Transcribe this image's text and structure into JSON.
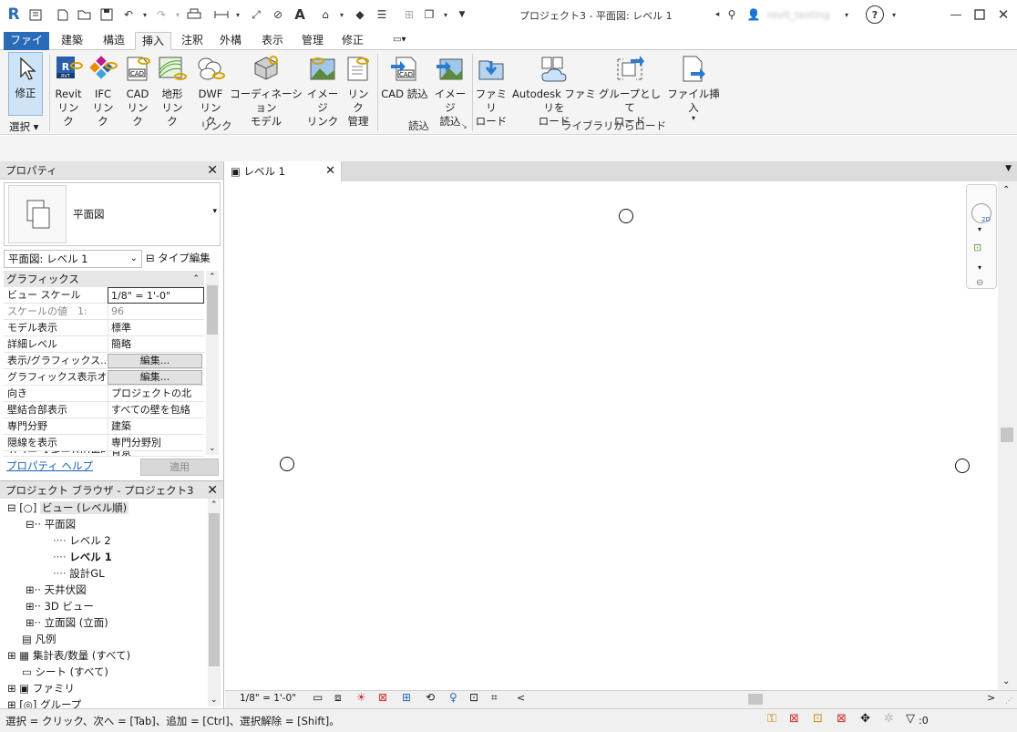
{
  "title_bar": {
    "title": "プロジェクト3 - 平面図: レベル 1",
    "user_name": "revit_testing",
    "help_label": "?"
  },
  "ribbon_tabs": [
    "ファイル",
    "建築",
    "構造",
    "挿入",
    "注釈",
    "外構",
    "表示",
    "管理",
    "修正"
  ],
  "ribbon": {
    "modify_label": "修正",
    "select_label": "選択",
    "buttons": {
      "revit_link": [
        "Revit",
        "リンク"
      ],
      "ifc_link": [
        "IFC",
        "リンク"
      ],
      "cad_link": [
        "CAD",
        "リンク"
      ],
      "topo_link": [
        "地形",
        "リンク"
      ],
      "dwf_link": [
        "DWF",
        "リンク"
      ],
      "coord_model": [
        "コーディネーション",
        "モデル"
      ],
      "image_link": [
        "イメージ",
        "リンク"
      ],
      "manage_links": [
        "リンク",
        "管理"
      ],
      "cad_import": [
        "CAD 読込",
        ""
      ],
      "image_import": [
        "イメージ",
        "読込"
      ],
      "load_family": [
        "ファミリ",
        "ロード"
      ],
      "autodesk_family": [
        "Autodesk ファミリを",
        "ロード"
      ],
      "load_group": [
        "グループとして",
        "ロード"
      ],
      "insert_file": [
        "ファイル挿入",
        ""
      ]
    },
    "panels": {
      "link": "リンク",
      "import": "読込",
      "load_library": "ライブラリからロード"
    },
    "cad_icon_text": "CAD",
    "rvt_icon_text": "RVT"
  },
  "properties": {
    "header": "プロパティ",
    "type_name": "平面図",
    "instance_selector": "平面図: レベル 1",
    "edit_type": "タイプ編集",
    "group": "グラフィックス",
    "rows": [
      {
        "k": "ビュー スケール",
        "v": "1/8\" = 1'-0\""
      },
      {
        "k": "スケールの値　1:",
        "v": "96"
      },
      {
        "k": "モデル表示",
        "v": "標準"
      },
      {
        "k": "詳細レベル",
        "v": "簡略"
      },
      {
        "k": "表示/グラフィックス...",
        "v": "編集..."
      },
      {
        "k": "グラフィックス表示オ...",
        "v": "編集..."
      },
      {
        "k": "向き",
        "v": "プロジェクトの北"
      },
      {
        "k": "壁結合部表示",
        "v": "すべての壁を包絡"
      },
      {
        "k": "専門分野",
        "v": "建築"
      },
      {
        "k": "隠線を表示",
        "v": "専門分野別"
      },
      {
        "k": "カラー スキームの場所",
        "v": "背景"
      }
    ],
    "help_link": "プロパティ ヘルプ",
    "apply": "適用"
  },
  "browser": {
    "header": "プロジェクト ブラウザ - プロジェクト3",
    "items": [
      "ビュー (レベル順)",
      "平面図",
      "レベル 2",
      "レベル 1",
      "設計GL",
      "天井伏図",
      "3D ビュー",
      "立面図 (立面)",
      "凡例",
      "集計表/数量 (すべて)",
      "シート (すべて)",
      "ファミリ",
      "グループ"
    ]
  },
  "view_tab": {
    "label": "レベル 1"
  },
  "view_bar": {
    "scale": "1/8\" = 1'-0\""
  },
  "status": {
    "text": "選択 = クリック、次へ = [Tab]、追加 = [Ctrl]、選択解除 = [Shift]。",
    "filter_count": ":0"
  },
  "colors": {
    "accent": "#2a6bb8",
    "ribbon_bg": "#f4f4f4"
  }
}
